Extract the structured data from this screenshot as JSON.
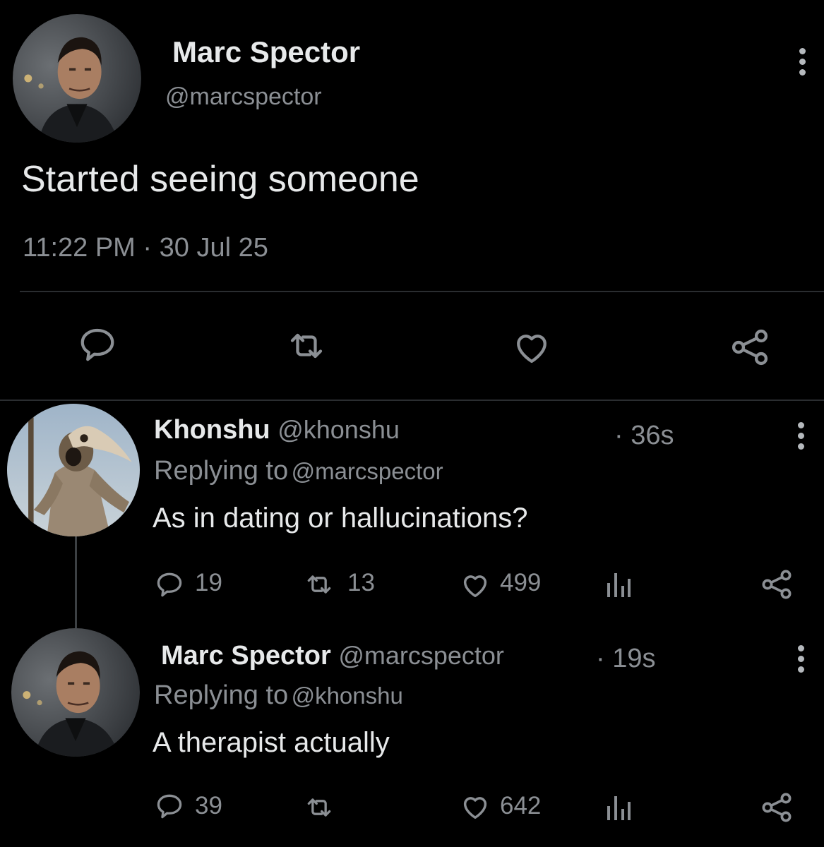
{
  "main_tweet": {
    "author_name": "Marc Spector",
    "author_handle": "@marcspector",
    "text": "Started seeing someone",
    "time": "11:22 PM",
    "separator": "·",
    "date": "30 Jul 25"
  },
  "replies": [
    {
      "author_name": "Khonshu",
      "author_handle": "@khonshu",
      "time": "· 36s",
      "replying_label": "Replying to",
      "replying_handle": "@marcspector",
      "text": "As in dating or hallucinations?",
      "reply_count": "19",
      "retweet_count": "13",
      "like_count": "499"
    },
    {
      "author_name": "Marc Spector",
      "author_handle": "@marcspector",
      "time": "· 19s",
      "replying_label": "Replying to",
      "replying_handle": "@khonshu",
      "text": "A therapist actually",
      "reply_count": "39",
      "retweet_count": "",
      "like_count": "642"
    }
  ],
  "icons": {
    "reply": "speech-bubble-icon",
    "retweet": "retweet-arrows-icon",
    "like": "heart-outline-icon",
    "share": "share-nodes-icon",
    "views": "bar-chart-icon",
    "more": "vertical-ellipsis-icon"
  },
  "colors": {
    "background": "#000000",
    "primary_text": "#e7e9ea",
    "secondary_text": "#8b8f94",
    "divider": "#2a2d30"
  }
}
